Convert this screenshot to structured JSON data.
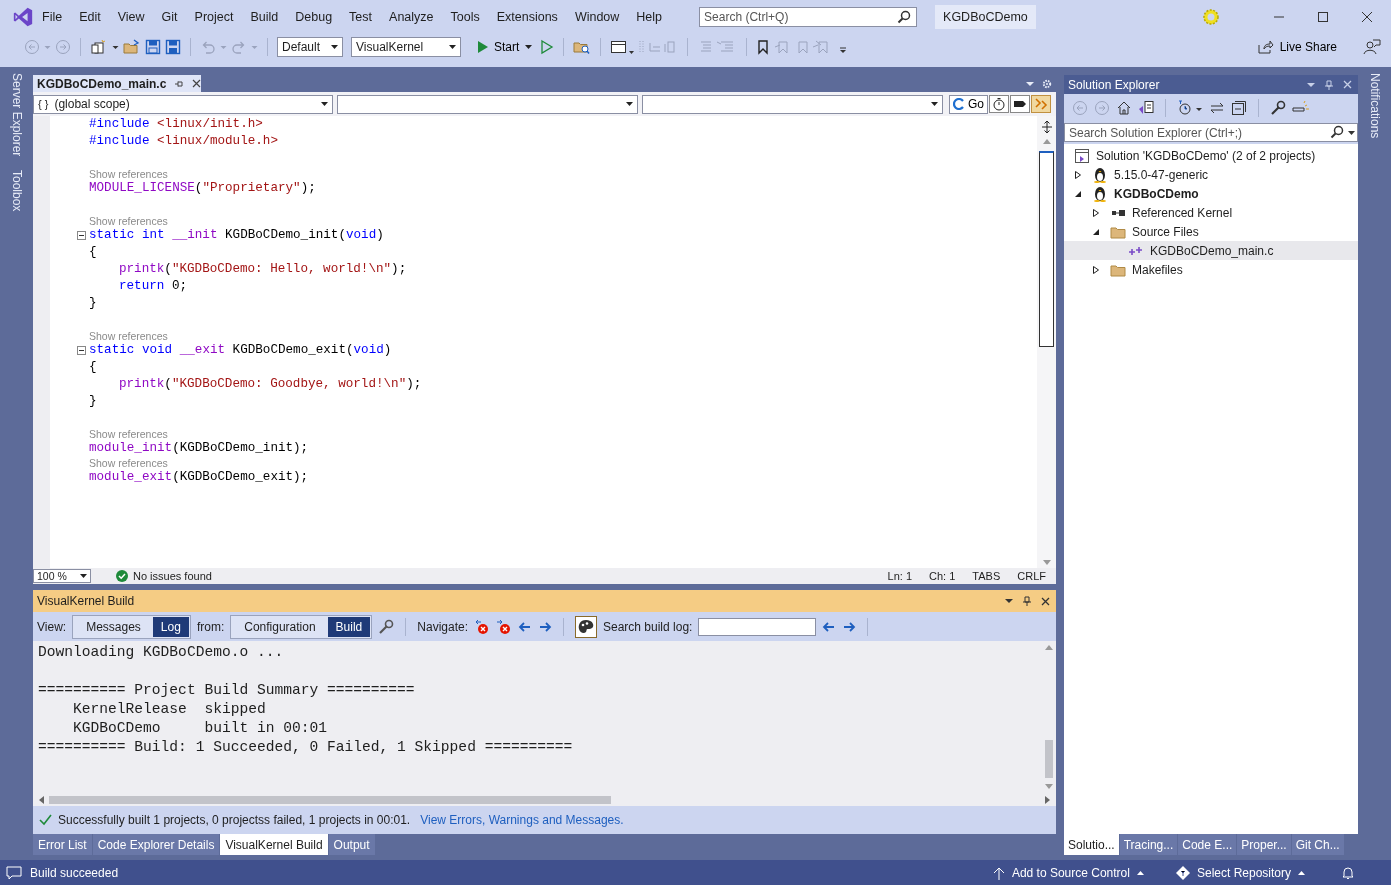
{
  "menu": {
    "items": [
      "File",
      "Edit",
      "View",
      "Git",
      "Project",
      "Build",
      "Debug",
      "Test",
      "Analyze",
      "Tools",
      "Extensions",
      "Window",
      "Help"
    ]
  },
  "title_search": {
    "placeholder": "Search (Ctrl+Q)"
  },
  "solution_badge": "KGDBoCDemo",
  "toolbar": {
    "configuration": "Default",
    "platform": "VisualKernel",
    "start": "Start",
    "live_share": "Live Share"
  },
  "left_side_tabs": [
    "Server Explorer",
    "Toolbox"
  ],
  "right_side_tabs": [
    "Notifications"
  ],
  "editor": {
    "tabs": [
      {
        "label": "KGDBoCDemo_main.c",
        "selected": true
      }
    ],
    "scope_icon": "{ }",
    "scope": "(global scope)",
    "go": "Go",
    "lines": [
      {
        "kind": "code",
        "tokens": [
          {
            "kind": "pp",
            "s": "#include "
          },
          {
            "kind": "str",
            "s": "<linux/init.h>"
          }
        ]
      },
      {
        "kind": "code",
        "tokens": [
          {
            "kind": "pp",
            "s": "#include "
          },
          {
            "kind": "str",
            "s": "<linux/module.h>"
          }
        ]
      },
      {
        "kind": "blank"
      },
      {
        "kind": "hint",
        "text": "Show references"
      },
      {
        "kind": "code",
        "tokens": [
          {
            "kind": "macro",
            "s": "MODULE_LICENSE"
          },
          {
            "kind": "plain",
            "s": "("
          },
          {
            "kind": "str",
            "s": "\"Proprietary\""
          },
          {
            "kind": "plain",
            "s": ");"
          }
        ]
      },
      {
        "kind": "blank"
      },
      {
        "kind": "hint",
        "text": "Show references"
      },
      {
        "kind": "code",
        "folded": false,
        "tokens": [
          {
            "kind": "kw",
            "s": "static int "
          },
          {
            "kind": "macro",
            "s": "__init "
          },
          {
            "kind": "plain",
            "s": "KGDBoCDemo_init("
          },
          {
            "kind": "kw",
            "s": "void"
          },
          {
            "kind": "plain",
            "s": ")"
          }
        ]
      },
      {
        "kind": "code",
        "tokens": [
          {
            "kind": "plain",
            "s": "{"
          }
        ]
      },
      {
        "kind": "code",
        "indented": true,
        "tokens": [
          {
            "kind": "macro",
            "s": "printk"
          },
          {
            "kind": "plain",
            "s": "("
          },
          {
            "kind": "str",
            "s": "\"KGDBoCDemo: Hello, world!\\n\""
          },
          {
            "kind": "plain",
            "s": ");"
          }
        ]
      },
      {
        "kind": "code",
        "indented": true,
        "tokens": [
          {
            "kind": "kw",
            "s": "return "
          },
          {
            "kind": "plain",
            "s": "0;"
          }
        ]
      },
      {
        "kind": "code",
        "tokens": [
          {
            "kind": "plain",
            "s": "}"
          }
        ]
      },
      {
        "kind": "blank"
      },
      {
        "kind": "hint",
        "text": "Show references"
      },
      {
        "kind": "code",
        "folded": false,
        "tokens": [
          {
            "kind": "kw",
            "s": "static void "
          },
          {
            "kind": "macro",
            "s": "__exit "
          },
          {
            "kind": "plain",
            "s": "KGDBoCDemo_exit("
          },
          {
            "kind": "kw",
            "s": "void"
          },
          {
            "kind": "plain",
            "s": ")"
          }
        ]
      },
      {
        "kind": "code",
        "tokens": [
          {
            "kind": "plain",
            "s": "{"
          }
        ]
      },
      {
        "kind": "code",
        "indented": true,
        "tokens": [
          {
            "kind": "macro",
            "s": "printk"
          },
          {
            "kind": "plain",
            "s": "("
          },
          {
            "kind": "str",
            "s": "\"KGDBoCDemo: Goodbye, world!\\n\""
          },
          {
            "kind": "plain",
            "s": ");"
          }
        ]
      },
      {
        "kind": "code",
        "tokens": [
          {
            "kind": "plain",
            "s": "}"
          }
        ]
      },
      {
        "kind": "blank"
      },
      {
        "kind": "hint",
        "text": "Show references"
      },
      {
        "kind": "code",
        "tokens": [
          {
            "kind": "macro",
            "s": "module_init"
          },
          {
            "kind": "plain",
            "s": "(KGDBoCDemo_init);"
          }
        ]
      },
      {
        "kind": "hint",
        "text": "Show references"
      },
      {
        "kind": "code",
        "tokens": [
          {
            "kind": "macro",
            "s": "module_exit"
          },
          {
            "kind": "plain",
            "s": "(KGDBoCDemo_exit);"
          }
        ]
      }
    ],
    "zoom": "100 %",
    "issues": "No issues found",
    "line_pos": "Ln: 1",
    "col_pos": "Ch: 1",
    "indent_mode": "TABS",
    "line_ending": "CRLF"
  },
  "build_panel": {
    "title": "VisualKernel Build",
    "view_label": "View:",
    "view_options": [
      {
        "label": "Messages",
        "selected": false
      },
      {
        "label": "Log",
        "selected": true
      }
    ],
    "from_label": "from:",
    "from_options": [
      {
        "label": "Configuration",
        "selected": false
      },
      {
        "label": "Build",
        "selected": true
      }
    ],
    "navigate_label": "Navigate:",
    "search_label": "Search build log:",
    "log_blocks": [
      [
        "Downloading KGDBoCDemo.o ..."
      ],
      [
        "========== Project Build Summary ==========",
        "    KernelRelease  skipped",
        "    KGDBoCDemo     built in 00:01",
        "========== Build: 1 Succeeded, 0 Failed, 1 Skipped =========="
      ]
    ],
    "summary": "Successfully built 1 projects, 0 projectss failed, 1 projects in 00:01.",
    "summary_link": "View Errors, Warnings and Messages."
  },
  "bottom_tabs": [
    {
      "label": "Error List",
      "selected": false
    },
    {
      "label": "Code Explorer Details",
      "selected": false
    },
    {
      "label": "VisualKernel Build",
      "selected": true
    },
    {
      "label": "Output",
      "selected": false
    }
  ],
  "solution_explorer": {
    "title": "Solution Explorer",
    "search": {
      "placeholder": "Search Solution Explorer (Ctrl+;)"
    },
    "tree": [
      {
        "kind": "solution",
        "label": "Solution 'KGDBoCDemo' (2 of 2 projects)",
        "bold": false,
        "selected": false
      },
      {
        "kind": "project",
        "label": "5.15.0-47-generic",
        "bold": false,
        "selected": false,
        "expanded": false
      },
      {
        "kind": "project",
        "label": "KGDBoCDemo",
        "bold": true,
        "selected": false,
        "expanded": true,
        "children": [
          {
            "kind": "reference",
            "label": "Referenced Kernel",
            "bold": false,
            "selected": false,
            "expanded": false
          },
          {
            "kind": "folder",
            "label": "Source Files",
            "bold": false,
            "selected": false,
            "expanded": true,
            "children": [
              {
                "kind": "file",
                "label": "KGDBoCDemo_main.c",
                "bold": false,
                "selected": true
              }
            ]
          },
          {
            "kind": "folder",
            "label": "Makefiles",
            "bold": false,
            "selected": false,
            "expanded": false
          }
        ]
      }
    ]
  },
  "right_tabs": [
    {
      "label": "Solutio...",
      "selected": true
    },
    {
      "label": "Tracing...",
      "selected": false
    },
    {
      "label": "Code E...",
      "selected": false
    },
    {
      "label": "Proper...",
      "selected": false
    },
    {
      "label": "Git Ch...",
      "selected": false
    }
  ],
  "status_bar": {
    "message": "Build succeeded",
    "source_control": "Add to Source Control",
    "repository": "Select Repository"
  }
}
